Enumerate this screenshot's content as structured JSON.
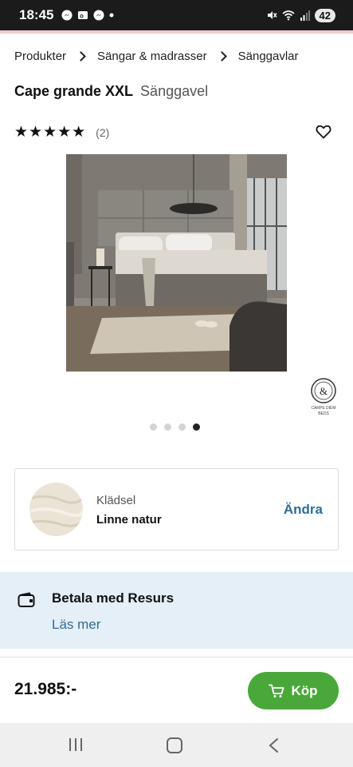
{
  "status_bar": {
    "time": "18:45",
    "battery": "42",
    "left_icons": [
      "messenger-icon",
      "outlook-icon",
      "messenger-icon"
    ],
    "right_icons": [
      "mute-icon",
      "wifi-icon",
      "signal-icon",
      "battery-icon"
    ]
  },
  "breadcrumb": {
    "items": [
      "Produkter",
      "Sängar & madrasser",
      "Sänggavlar"
    ]
  },
  "product": {
    "name": "Cape grande XXL",
    "category": "Sänggavel",
    "stars": "★★★★★",
    "rating_value": 5,
    "review_count": "(2)"
  },
  "gallery": {
    "dot_count": 4,
    "active_dot": 4
  },
  "fabric": {
    "label": "Klädsel",
    "value": "Linne natur",
    "change_label": "Ändra"
  },
  "payment": {
    "title": "Betala med Resurs",
    "link": "Läs mer"
  },
  "purchase": {
    "price": "21.985:-",
    "buy_label": "Köp"
  },
  "colors": {
    "accent_blue": "#2f6d97",
    "buy_green": "#4aa83b",
    "info_bg": "#e4eff8"
  }
}
